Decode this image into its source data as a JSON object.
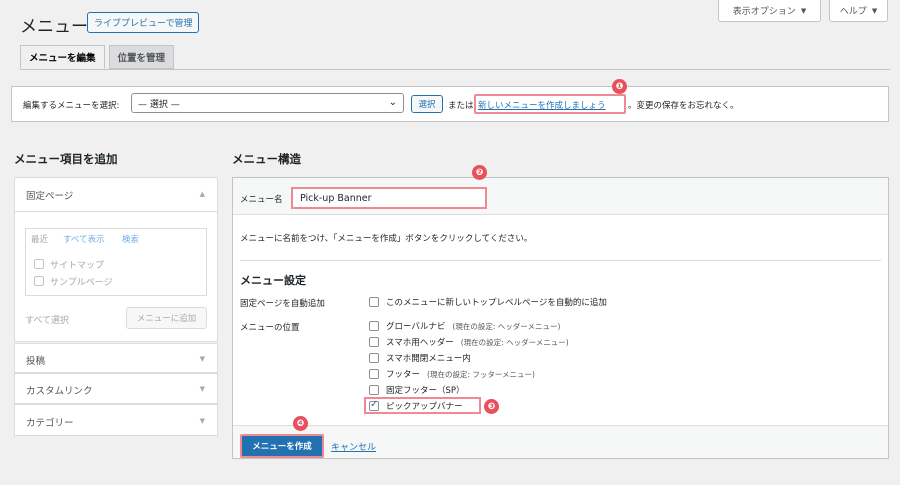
{
  "top_buttons": {
    "screen_options": "表示オプション",
    "help": "ヘルプ"
  },
  "header": {
    "title": "メニュー",
    "live_preview": "ライブプレビューで管理"
  },
  "tabs": [
    {
      "label": "メニューを編集"
    },
    {
      "label": "位置を管理"
    }
  ],
  "menu_select": {
    "label": "編集するメニューを選択:",
    "value": "— 選択 —",
    "select_button": "選択",
    "or_text": "または",
    "create_link": "新しいメニューを作成しましょう",
    "after_text": "。変更の保存をお忘れなく。"
  },
  "badges": [
    "❶",
    "❷",
    "❸",
    "❹"
  ],
  "left_panel": {
    "heading": "メニュー項目を追加",
    "fixed_pages": {
      "title": "固定ページ",
      "tabs": [
        "最近",
        "すべて表示",
        "検索"
      ],
      "items": [
        "サイトマップ",
        "サンプルページ"
      ],
      "select_all": "すべて選択",
      "add_button": "メニューに追加"
    },
    "sections": [
      "投稿",
      "カスタムリンク",
      "カテゴリー"
    ]
  },
  "structure": {
    "heading": "メニュー構造",
    "name_label": "メニュー名",
    "name_value": "Pick-up Banner",
    "hint": "メニューに名前をつけ、「メニューを作成」ボタンをクリックしてください。",
    "settings_heading": "メニュー設定",
    "auto_add_label": "固定ページを自動追加",
    "auto_add_option": "このメニューに新しいトップレベルページを自動的に追加",
    "location_label": "メニューの位置",
    "locations": [
      {
        "label": "グローバルナビ",
        "note": "(現在の設定: ヘッダーメニュー)",
        "checked": false
      },
      {
        "label": "スマホ用ヘッダー",
        "note": "(現在の設定: ヘッダーメニュー)",
        "checked": false
      },
      {
        "label": "スマホ開閉メニュー内",
        "note": "",
        "checked": false
      },
      {
        "label": "フッター",
        "note": "(現在の設定: フッターメニュー)",
        "checked": false
      },
      {
        "label": "固定フッター（SP）",
        "note": "",
        "checked": false
      },
      {
        "label": "ピックアップバナー",
        "note": "",
        "checked": true
      }
    ],
    "create_button": "メニューを作成",
    "cancel": "キャンセル"
  },
  "colors": {
    "accent": "#2271b1",
    "highlight": "#f08a92",
    "badge": "#e8505b"
  }
}
